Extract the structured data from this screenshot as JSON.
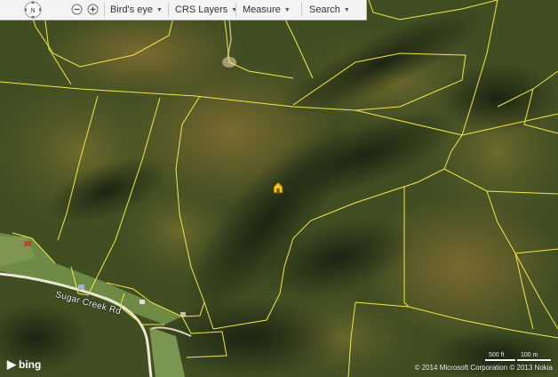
{
  "toolbar": {
    "compass_label": "N",
    "birds_eye": "Bird's eye",
    "crs_layers": "CRS Layers",
    "measure": "Measure",
    "search": "Search",
    "caret": "▼"
  },
  "map": {
    "road_label": "Sugar Creek Rd",
    "logo_text": "bing",
    "copyright": "© 2014 Microsoft Corporation  © 2013 Nokia",
    "scale_short": "500 ft",
    "scale_long": "100 m",
    "colors": {
      "parcel_lines": "#f2e84a",
      "marker": "#f5c518",
      "forest_dark": "#2d3a1c",
      "forest_light": "#5c6a2e",
      "field": "#6f8a45",
      "road": "#ece6d4"
    }
  }
}
